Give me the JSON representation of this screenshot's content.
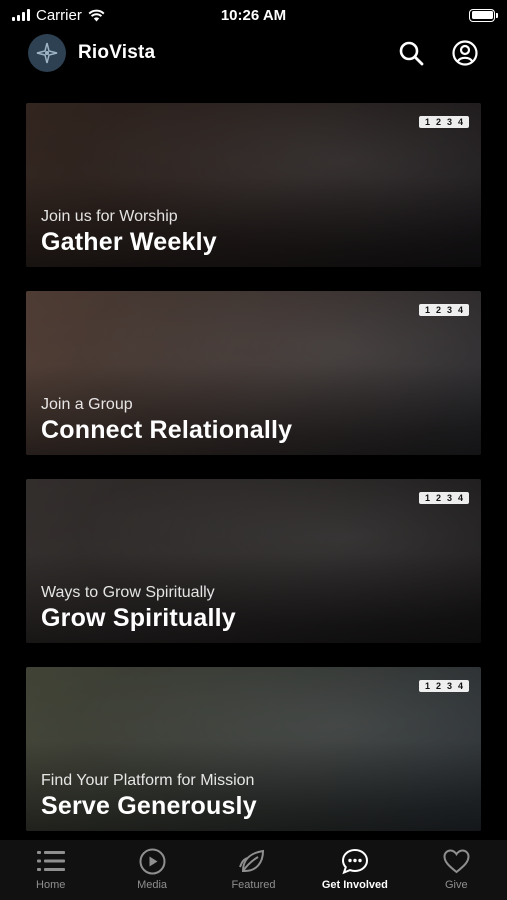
{
  "status": {
    "carrier": "Carrier",
    "time": "10:26 AM"
  },
  "header": {
    "title": "RioVista",
    "search_icon": "search-icon",
    "profile_icon": "user-circle-icon",
    "logo_icon": "compass-logo"
  },
  "cards": [
    {
      "subtitle": "Join us for Worship",
      "title": "Gather Weekly",
      "badge": [
        "1",
        "2",
        "3",
        "4"
      ],
      "tone": [
        "#3a2b24",
        "#1c1a1d"
      ]
    },
    {
      "subtitle": "Join a Group",
      "title": "Connect Relationally",
      "badge": [
        "1",
        "2",
        "3",
        "4"
      ],
      "tone": [
        "#5b463c",
        "#2a2a2e"
      ]
    },
    {
      "subtitle": "Ways to Grow Spiritually",
      "title": "Grow Spiritually",
      "badge": [
        "1",
        "2",
        "3",
        "4"
      ],
      "tone": [
        "#3b3634",
        "#1d1b1c"
      ]
    },
    {
      "subtitle": "Find Your Platform for Mission",
      "title": "Serve Generously",
      "badge": [
        "1",
        "2",
        "3",
        "4"
      ],
      "tone": [
        "#4c4e3f",
        "#2d3339"
      ]
    }
  ],
  "tabs": [
    {
      "label": "Home",
      "icon": "list-icon",
      "active": false
    },
    {
      "label": "Media",
      "icon": "play-circle-icon",
      "active": false
    },
    {
      "label": "Featured",
      "icon": "leaf-icon",
      "active": false
    },
    {
      "label": "Get Involved",
      "icon": "chat-bubble-icon",
      "active": true
    },
    {
      "label": "Give",
      "icon": "heart-icon",
      "active": false
    }
  ]
}
